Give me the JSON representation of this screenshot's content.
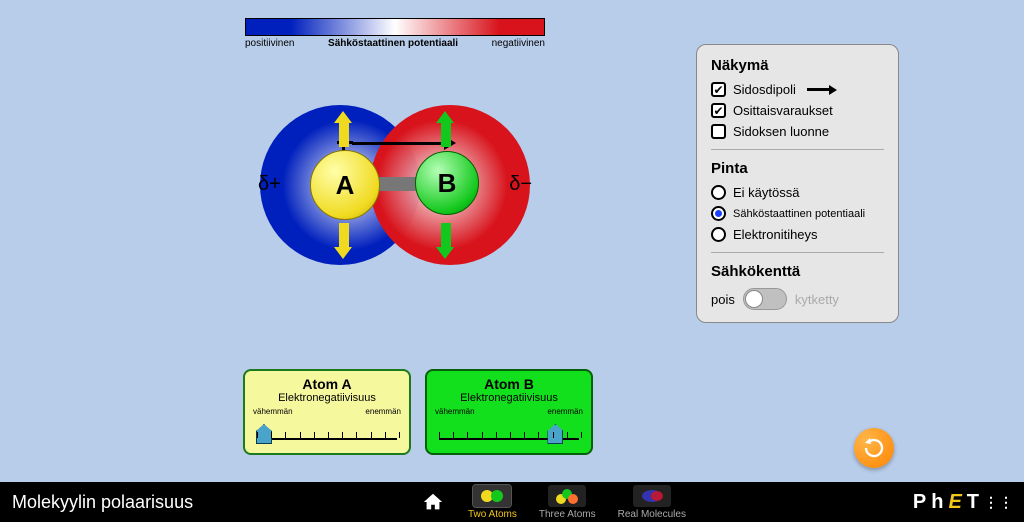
{
  "legend": {
    "left": "positiivinen",
    "center": "Sähköstaattinen potentiaali",
    "right": "negatiivinen"
  },
  "molecule": {
    "atom_a_label": "A",
    "atom_b_label": "B",
    "delta_plus": "δ+",
    "delta_minus": "δ−"
  },
  "panel": {
    "view_heading": "Näkymä",
    "bond_dipole": {
      "label": "Sidosdipoli",
      "checked": true
    },
    "partial_charges": {
      "label": "Osittaisvaraukset",
      "checked": true
    },
    "bond_character": {
      "label": "Sidoksen luonne",
      "checked": false
    },
    "surface_heading": "Pinta",
    "surface_options": [
      {
        "label": "Ei käytössä",
        "selected": false
      },
      {
        "label": "Sähköstaattinen potentiaali",
        "selected": true
      },
      {
        "label": "Elektronitiheys",
        "selected": false
      }
    ],
    "efield_heading": "Sähkökenttä",
    "efield": {
      "off": "pois",
      "on": "kytketty",
      "value": false
    }
  },
  "sliders": {
    "a": {
      "title": "Atom A",
      "subtitle": "Elektronegatiivisuus",
      "min": "vähemmän",
      "max": "enemmän",
      "value": 0.05
    },
    "b": {
      "title": "Atom B",
      "subtitle": "Elektronegatiivisuus",
      "min": "vähemmän",
      "max": "enemmän",
      "value": 0.78
    }
  },
  "bottom": {
    "sim_title": "Molekyylin polaarisuus",
    "tabs": [
      {
        "id": "two",
        "label": "Two Atoms",
        "active": true
      },
      {
        "id": "three",
        "label": "Three Atoms",
        "active": false
      },
      {
        "id": "real",
        "label": "Real Molecules",
        "active": false
      }
    ],
    "brand": "PhET"
  }
}
